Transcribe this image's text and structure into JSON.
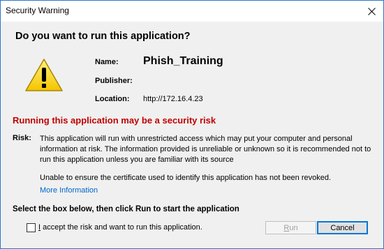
{
  "window": {
    "title": "Security Warning"
  },
  "dialog": {
    "question": "Do you want to run this application?",
    "name_label": "Name:",
    "name_value": "Phish_Training",
    "publisher_label": "Publisher:",
    "location_label": "Location:",
    "location_value": "http://172.16.4.23",
    "risk_heading": "Running this application may be a security risk",
    "risk_label": "Risk:",
    "risk_text": "This application will run with unrestricted access which may put your computer and personal information at risk. The information provided is unreliable or unknown so it is recommended not to run this application unless you are familiar with its source",
    "risk_text2": "Unable to ensure the certificate used to identify this application has not been revoked.",
    "more_info": "More Information",
    "instruction": "Select the box below, then click Run to start the application",
    "accept_first": "I",
    "accept_rest": " accept the risk and want to run this application.",
    "accept_checked": false,
    "run_first": "R",
    "run_rest": "un",
    "run_enabled": false,
    "cancel_label": "Cancel"
  },
  "icons": {
    "warning": "warning-triangle-icon",
    "close": "close-icon"
  },
  "colors": {
    "risk_heading": "#c00000",
    "link": "#0066cc",
    "window_border": "#2b78c8",
    "focus_border": "#0078d7"
  }
}
